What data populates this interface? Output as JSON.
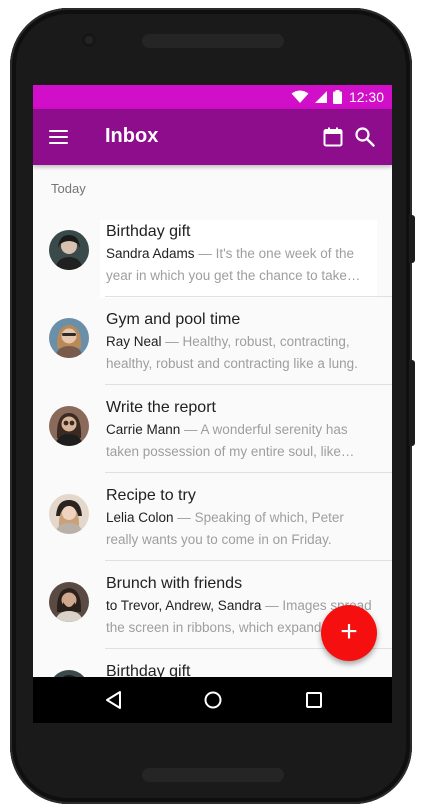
{
  "status_bar": {
    "time": "12:30",
    "background": "#d10ec8"
  },
  "app_bar": {
    "title": "Inbox",
    "background": "#8e0d8d",
    "icons": [
      "menu-icon",
      "calendar-icon",
      "search-icon"
    ]
  },
  "section": {
    "header": "Today"
  },
  "messages": [
    {
      "subject": "Birthday gift",
      "sender": "Sandra Adams",
      "separator": " — ",
      "snippet_1": "It's the one week of the",
      "snippet_2": "year in which you get the chance to take…",
      "avatar_color": "#3a4a4a"
    },
    {
      "subject": "Gym and pool time",
      "sender": "Ray Neal",
      "separator": " — ",
      "snippet_1": "Healthy, robust, contracting,",
      "snippet_2": "healthy, robust and contracting like a lung.",
      "avatar_color": "#6a8fa8"
    },
    {
      "subject": "Write the report",
      "sender": "Carrie Mann",
      "separator": " — ",
      "snippet_1": "A wonderful serenity has",
      "snippet_2": "taken possession of my entire soul, like…",
      "avatar_color": "#8a6a5a"
    },
    {
      "subject": "Recipe to try",
      "sender": "Lelia Colon",
      "separator": " — ",
      "snippet_1": "Speaking of which, Peter",
      "snippet_2": "really wants you to come in on Friday.",
      "avatar_color": "#d8c8b8"
    },
    {
      "subject": "Brunch with friends",
      "sender": "to Trevor, Andrew, Sandra",
      "separator": " — ",
      "snippet_1": "Images spread",
      "snippet_2": "the screen in ribbons, which expanded",
      "avatar_color": "#5a4a44"
    },
    {
      "subject": "Birthday gift",
      "sender": "",
      "separator": "",
      "snippet_1": "",
      "snippet_2": "",
      "avatar_color": "#3a4a4a"
    }
  ],
  "fab": {
    "label": "+",
    "background": "#f50f0f"
  },
  "nav_bar": {
    "icons": [
      "back-icon",
      "home-icon",
      "recents-icon"
    ]
  }
}
